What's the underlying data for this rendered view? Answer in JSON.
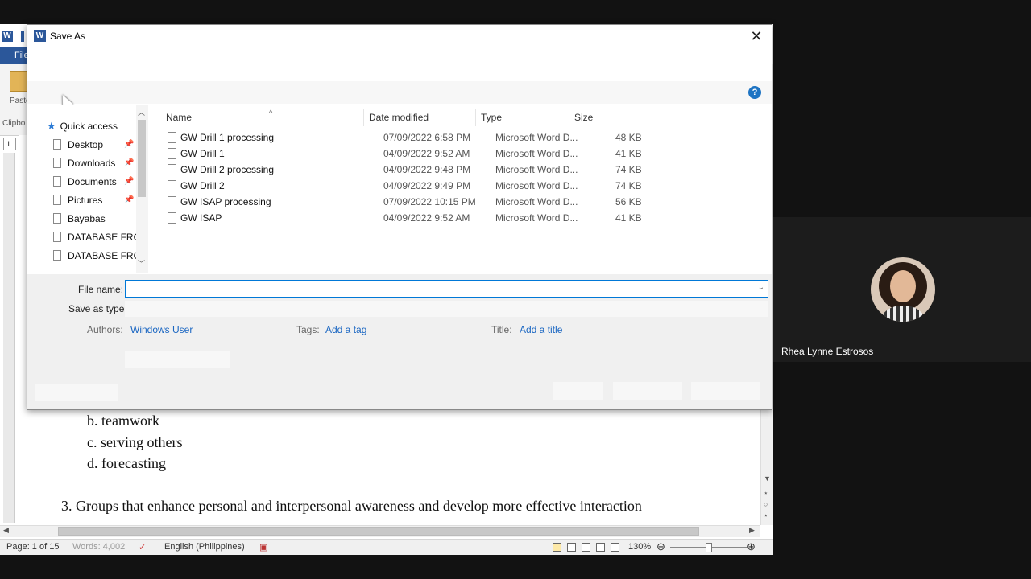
{
  "word": {
    "file_tab": "File",
    "paste_label": "Paste",
    "clipboard_label": "Clipbo",
    "doc_lines": [
      "b. teamwork",
      "c. serving others",
      "d. forecasting",
      "3.    Groups that enhance personal and interpersonal awareness and develop more effective interaction"
    ],
    "status": {
      "page": "Page: 1 of 15",
      "words": "Words: 4,002",
      "language": "English (Philippines)",
      "zoom": "130%"
    }
  },
  "dialog": {
    "title": "Save As",
    "help": "?",
    "close": "✕",
    "nav": {
      "items": [
        {
          "label": "Quick access",
          "kind": "star"
        },
        {
          "label": "Desktop",
          "pinned": true
        },
        {
          "label": "Downloads",
          "pinned": true
        },
        {
          "label": "Documents",
          "pinned": true
        },
        {
          "label": "Pictures",
          "pinned": true
        },
        {
          "label": "Bayabas",
          "pinned": false
        },
        {
          "label": "DATABASE FROM",
          "pinned": false
        },
        {
          "label": "DATABASE FROM",
          "pinned": false
        }
      ]
    },
    "columns": {
      "name": "Name",
      "date": "Date modified",
      "type": "Type",
      "size": "Size"
    },
    "files": [
      {
        "name": "GW Drill 1 processing",
        "date": "07/09/2022 6:58 PM",
        "type": "Microsoft Word D...",
        "size": "48 KB"
      },
      {
        "name": "GW Drill 1",
        "date": "04/09/2022 9:52 AM",
        "type": "Microsoft Word D...",
        "size": "41 KB"
      },
      {
        "name": "GW Drill 2 processing",
        "date": "04/09/2022 9:48 PM",
        "type": "Microsoft Word D...",
        "size": "74 KB"
      },
      {
        "name": "GW Drill 2",
        "date": "04/09/2022 9:49 PM",
        "type": "Microsoft Word D...",
        "size": "74 KB"
      },
      {
        "name": "GW ISAP processing",
        "date": "07/09/2022 10:15 PM",
        "type": "Microsoft Word D...",
        "size": "56 KB"
      },
      {
        "name": "GW ISAP",
        "date": "04/09/2022 9:52 AM",
        "type": "Microsoft Word D...",
        "size": "41 KB"
      }
    ],
    "form": {
      "file_name_label": "File name:",
      "file_name_value": "",
      "save_as_type_label": "Save as type:",
      "authors_label": "Authors:",
      "authors_value": "Windows User",
      "tags_label": "Tags:",
      "tags_value": "Add a tag",
      "title_label": "Title:",
      "title_value": "Add a title"
    }
  },
  "participant": {
    "name": "Rhea Lynne Estrosos"
  }
}
